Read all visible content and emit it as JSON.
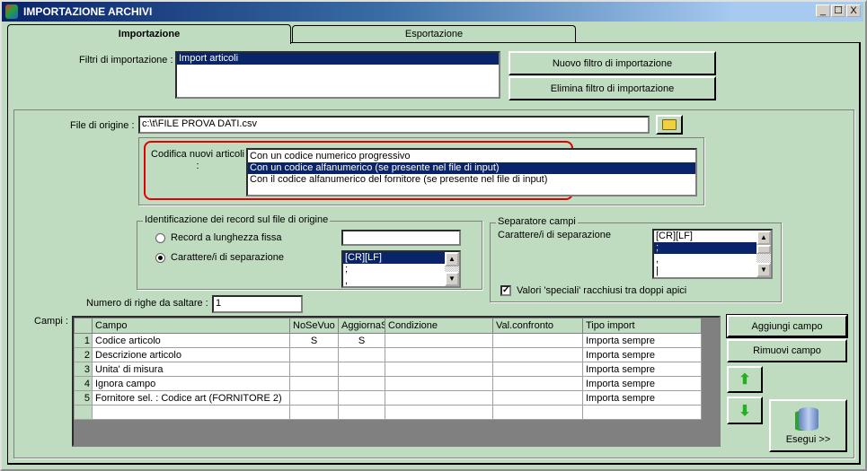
{
  "window": {
    "title": "IMPORTAZIONE ARCHIVI",
    "minimize": "_",
    "maximize": "☐",
    "close": "X"
  },
  "tabs": [
    {
      "label": "Importazione"
    },
    {
      "label": "Esportazione"
    }
  ],
  "filters": {
    "label": "Filtri di importazione :",
    "items": [
      "Import articoli"
    ],
    "new_button": "Nuovo filtro di importazione",
    "delete_button": "Elimina filtro di importazione"
  },
  "file": {
    "label": "File di origine :",
    "value": "c:\\t\\FILE PROVA DATI.csv"
  },
  "codifica": {
    "label": "Codifica nuovi articoli :",
    "items": [
      "Con un codice numerico progressivo",
      "Con un codice alfanumerico (se presente nel file di input)",
      "Con il codice alfanumerico del fornitore (se presente nel file di input)"
    ]
  },
  "identificazione": {
    "title": "Identificazione dei record sul file di origine",
    "radio1": "Record a lunghezza fissa",
    "radio2": "Carattere/i di separazione",
    "length_value": "",
    "sep_items": [
      "[CR][LF]",
      ";",
      ","
    ]
  },
  "separatore": {
    "title": "Separatore campi",
    "label": "Carattere/i di separazione",
    "items": [
      "[CR][LF]",
      ";",
      ",",
      "|"
    ],
    "checkbox": "Valori 'speciali' racchiusi tra doppi apici",
    "checked": true
  },
  "skip": {
    "label": "Numero di righe da saltare :",
    "value": "1"
  },
  "campi": {
    "label": "Campi :",
    "columns": [
      "Campo",
      "NoSeVuo",
      "AggiornaS",
      "Condizione",
      "Val.confronto",
      "Tipo import"
    ],
    "rows": [
      [
        "1",
        "Codice articolo",
        "S",
        "S",
        "",
        "",
        "Importa sempre"
      ],
      [
        "2",
        "Descrizione articolo",
        "",
        "",
        "",
        "",
        "Importa sempre"
      ],
      [
        "3",
        "Unita' di misura",
        "",
        "",
        "",
        "",
        "Importa sempre"
      ],
      [
        "4",
        "Ignora campo",
        "",
        "",
        "",
        "",
        "Importa sempre"
      ],
      [
        "5",
        "Fornitore sel. : Codice art (FORNITORE 2)",
        "",
        "",
        "",
        "",
        "Importa sempre"
      ],
      [
        "",
        "",
        "",
        "",
        "",
        "",
        ""
      ]
    ]
  },
  "buttons": {
    "add": "Aggiungi campo",
    "remove": "Rimuovi campo",
    "run": "Esegui >>"
  }
}
